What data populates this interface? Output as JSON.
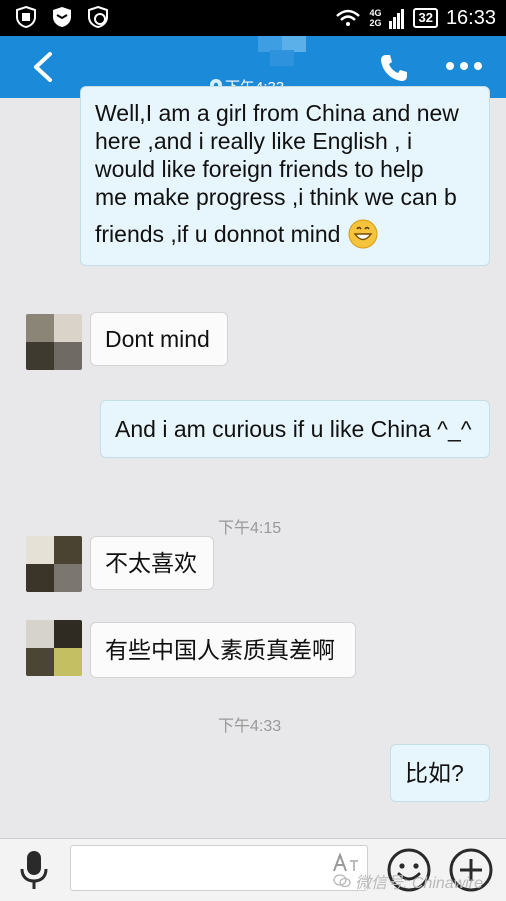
{
  "status_bar": {
    "network_top": "4G",
    "network_bottom": "2G",
    "battery": "32",
    "time": "16:33"
  },
  "header": {
    "subtitle_time": "下午4:33"
  },
  "colors": {
    "header_bg": "#1b8ad8",
    "chat_bg": "#e8e8ea",
    "outgoing_bubble": "#e7f6fc",
    "incoming_bubble": "#fbfbfb"
  },
  "messages": [
    {
      "direction": "outgoing",
      "lines": [
        "Well,I am a girl from China and new",
        "here ,and i really like English , i",
        "would like foreign friends to help",
        "me make progress ,i think we can b",
        "friends ,if u donnot mind"
      ],
      "emoji": "grinning-face-icon"
    },
    {
      "direction": "incoming",
      "text": "Dont mind"
    },
    {
      "direction": "outgoing",
      "text": "And i am curious if u like China ^_^"
    },
    {
      "type": "time",
      "text": "下午4:15"
    },
    {
      "direction": "incoming",
      "text": "不太喜欢"
    },
    {
      "direction": "incoming",
      "text": "有些中国人素质真差啊"
    },
    {
      "type": "time",
      "text": "下午4:33"
    },
    {
      "direction": "outgoing",
      "text": "比如?"
    }
  ],
  "input_bar": {
    "value": "",
    "watermark": "微信号: Chinawire"
  }
}
